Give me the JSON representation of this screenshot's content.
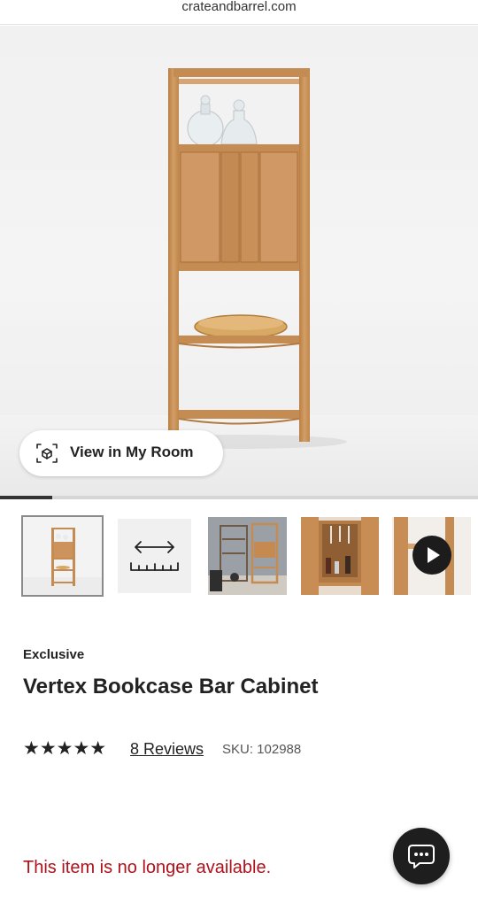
{
  "browser": {
    "url": "crateandbarrel.com"
  },
  "hero": {
    "view_in_room_label": "View in My Room",
    "gallery_progress": 0.11
  },
  "thumbnails": [
    {
      "name": "front-view",
      "selected": true
    },
    {
      "name": "dimensions",
      "selected": false
    },
    {
      "name": "room-scene",
      "selected": false
    },
    {
      "name": "interior-detail",
      "selected": false
    },
    {
      "name": "video",
      "selected": false
    }
  ],
  "product": {
    "eyebrow": "Exclusive",
    "title": "Vertex Bookcase Bar Cabinet",
    "stars": "★★★★★",
    "rating": 5,
    "reviews_label": "8 Reviews",
    "sku_label": "SKU: 102988",
    "availability": "This item is no longer available."
  },
  "colors": {
    "unavailable_text": "#b0111b",
    "chat_button": "#1e1e1e",
    "wood": "#c9915a"
  },
  "icons": {
    "view_room": "ar-cube-icon",
    "dimensions": "ruler-arrows-icon",
    "video": "play-icon",
    "chat": "chat-bubble-icon"
  }
}
